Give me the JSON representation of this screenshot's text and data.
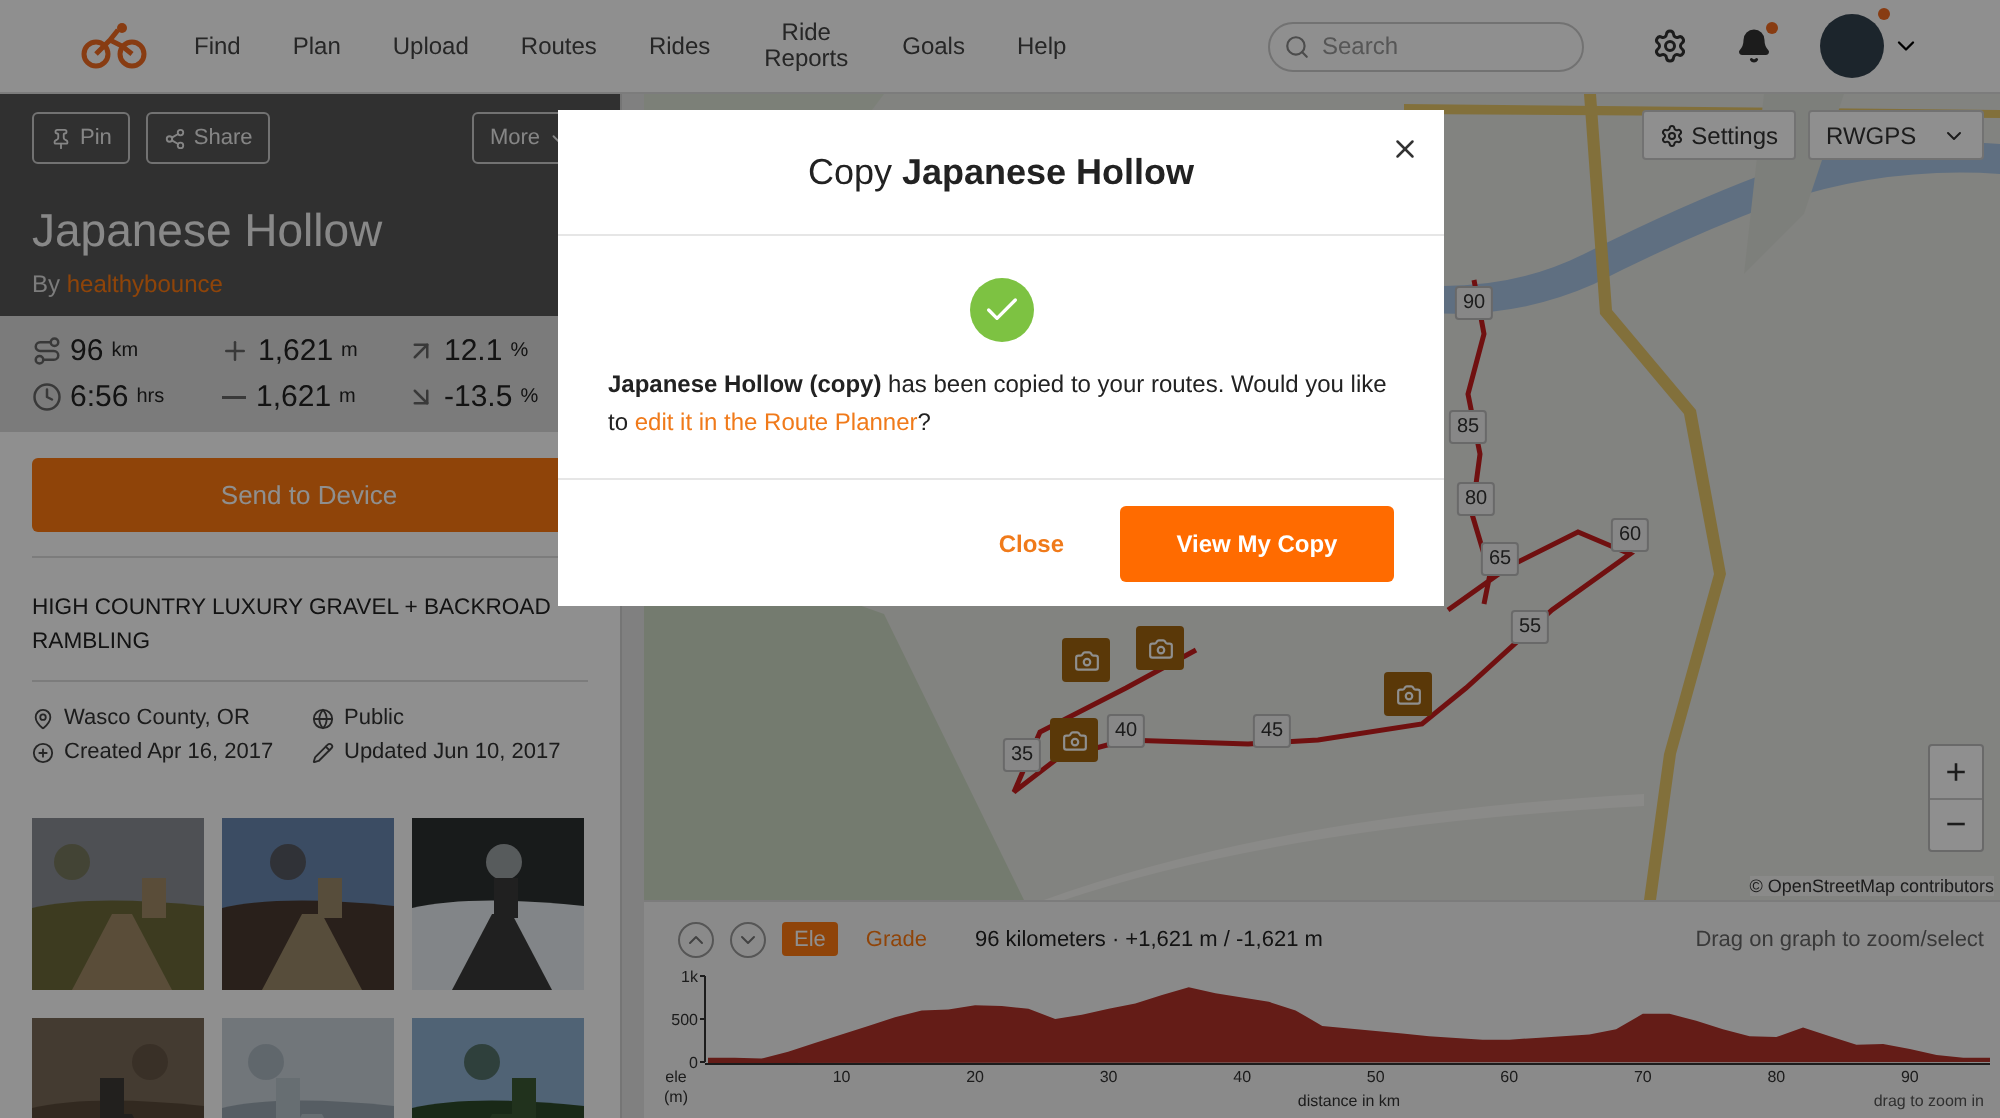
{
  "header": {
    "nav": [
      "Find",
      "Plan",
      "Upload",
      "Routes",
      "Rides",
      "Ride Reports",
      "Goals",
      "Help"
    ],
    "search": {
      "placeholder": "Search"
    },
    "bell": {
      "unread": true
    },
    "avatar": {
      "unread": true
    }
  },
  "route": {
    "actions": [
      {
        "kind": "pin",
        "label": "Pin"
      },
      {
        "kind": "share",
        "label": "Share"
      },
      {
        "kind": "more",
        "label": "More"
      }
    ],
    "title": "Japanese Hollow",
    "by": "By",
    "author": "healthybounce",
    "stats": [
      {
        "kind": "distance",
        "value": "96",
        "unit": "km"
      },
      {
        "kind": "gain",
        "value": "1,621",
        "unit": "m"
      },
      {
        "kind": "max_grade",
        "value": "12.1",
        "unit": "%"
      },
      {
        "kind": "time",
        "value": "6:56",
        "unit": "hrs"
      },
      {
        "kind": "loss",
        "value": "1,621",
        "unit": "m"
      },
      {
        "kind": "min_grade",
        "value": "-13.5",
        "unit": "%"
      }
    ],
    "send_button": "Send to Device",
    "description": "HIGH COUNTRY LUXURY GRAVEL + BACKROAD RAMBLING",
    "meta": [
      {
        "kind": "location",
        "text": "Wasco County, OR"
      },
      {
        "kind": "visibility",
        "text": "Public"
      },
      {
        "kind": "created",
        "text": "Created Apr 16, 2017"
      },
      {
        "kind": "updated",
        "text": "Updated Jun 10, 2017"
      }
    ]
  },
  "map": {
    "settings_button": "Settings",
    "layer_select": "RWGPS",
    "markers": [
      {
        "label": "90"
      },
      {
        "label": "85"
      },
      {
        "label": "80"
      },
      {
        "label": "65"
      },
      {
        "label": "60"
      },
      {
        "label": "55"
      },
      {
        "label": "45"
      },
      {
        "label": "40"
      },
      {
        "label": "35"
      }
    ],
    "zoom_in": "+",
    "zoom_out": "−",
    "attribution": "© OpenStreetMap contributors"
  },
  "elevation": {
    "tabs": [
      {
        "label": "Ele",
        "selected": true
      },
      {
        "label": "Grade",
        "selected": false
      }
    ],
    "summary": "96 kilometers · +1,621 m / -1,621 m",
    "hint": "Drag on graph to zoom/select",
    "drag_hint": "drag to zoom in",
    "chart_data": {
      "type": "area",
      "xlabel": "distance in km",
      "ylabel": "ele (m)",
      "x": [
        0,
        2,
        4,
        6,
        8,
        10,
        12,
        14,
        16,
        18,
        20,
        22,
        24,
        26,
        28,
        30,
        32,
        34,
        36,
        38,
        40,
        42,
        44,
        46,
        48,
        50,
        52,
        54,
        56,
        58,
        60,
        62,
        64,
        66,
        68,
        70,
        72,
        74,
        76,
        78,
        80,
        82,
        84,
        86,
        88,
        90,
        92,
        94,
        96
      ],
      "series": [
        {
          "color": "#b3322a",
          "values": [
            50,
            50,
            40,
            120,
            220,
            320,
            420,
            520,
            600,
            610,
            660,
            650,
            620,
            500,
            550,
            620,
            680,
            780,
            870,
            800,
            750,
            700,
            600,
            420,
            390,
            360,
            330,
            300,
            280,
            260,
            260,
            280,
            300,
            320,
            380,
            560,
            560,
            480,
            380,
            300,
            290,
            400,
            300,
            200,
            210,
            150,
            80,
            50,
            50
          ]
        }
      ],
      "xlim": [
        0,
        96
      ],
      "ylim": [
        0,
        1000
      ],
      "xticks": [
        10,
        20,
        30,
        40,
        50,
        60,
        70,
        80,
        90
      ],
      "yticks": [
        0,
        500,
        {
          "value": 1000,
          "label": "1k"
        }
      ]
    }
  },
  "modal": {
    "title": "Copy **Japanese Hollow**",
    "message_before": "**Japanese Hollow (copy)** has been copied to your routes. Would you like to ",
    "link": "edit it in the Route Planner",
    "message_after": "?",
    "close": "Close",
    "primary": "View My Copy"
  }
}
